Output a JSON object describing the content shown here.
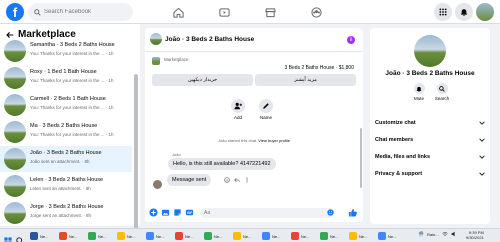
{
  "app": {
    "search_placeholder": "Search Facebook"
  },
  "sidebar": {
    "title": "Marketplace",
    "items": [
      {
        "title": "Samantha · 3 Beds 2 Baths House",
        "subtitle": "You: Thanks for your interest in the ... · 1h"
      },
      {
        "title": "Roxy · 1 Bed 1 Bath House",
        "subtitle": "You: Thanks for your interest in the ... · 1h"
      },
      {
        "title": "Carmell · 2 Beds 1 Bath House",
        "subtitle": "You: Thanks for your interest in the ... · 1h"
      },
      {
        "title": "Ma · 3 Beds 2 Baths House",
        "subtitle": "You: Thanks for your interest in the ... · 1h"
      },
      {
        "title": "João · 3 Beds 2 Baths House",
        "subtitle": "João sent an attachment. · 8h"
      },
      {
        "title": "Lelen · 3 Beds 2 Baths House",
        "subtitle": "Lelen sent an attachment. · 8h"
      },
      {
        "title": "Jorge · 3 Beds 2 Baths House",
        "subtitle": "Jorge sent an attachment. · 8h"
      }
    ]
  },
  "chat": {
    "title": "João · 3 Beds 2 Baths House",
    "listing": {
      "category": "Marketplace",
      "title": "3 Beds 2 Baths House · $1,800",
      "buttons": [
        "خریدار دیکھیں",
        "مزید آپشنز"
      ]
    },
    "actions": [
      "Add",
      "Name"
    ],
    "system_message": "João started this chat.",
    "system_link": "View buyer profile",
    "sender_name": "João",
    "incoming_message": "Hello, is this still available? 4147221492",
    "outgoing_message": "Message sent",
    "composer_placeholder": "Aa"
  },
  "details": {
    "title": "João · 3 Beds 2 Baths House",
    "actions": [
      "Mute",
      "Search"
    ],
    "sections": [
      "Customize chat",
      "Chat members",
      "Media, files and links",
      "Privacy & support"
    ]
  },
  "taskbar": {
    "apps": [
      "Ne...",
      "Ne...",
      "Ne...",
      "Ne...",
      "Ne...",
      "Ne...",
      "Ne...",
      "Ne...",
      "Ne...",
      "Ne...",
      "Ne...",
      "Ne...",
      "Ne..."
    ],
    "weather": "Rain...",
    "time": "9:39 PM",
    "date": "9/30/2021"
  },
  "colors": {
    "accent": "#1877f2",
    "info": "#a033ff",
    "active_row": "#e7f3ff"
  }
}
